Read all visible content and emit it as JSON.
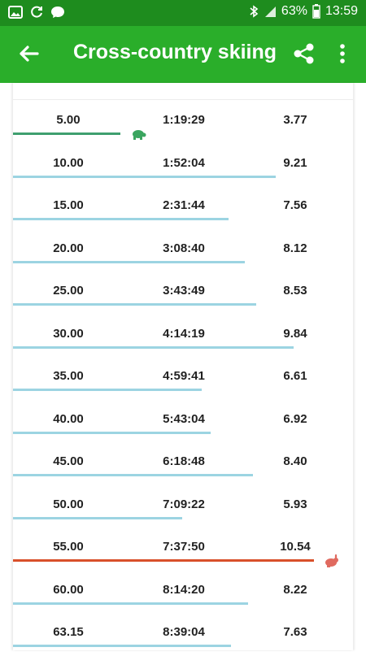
{
  "status_bar": {
    "battery": "63%",
    "time": "13:59",
    "left_icons": [
      "gallery-icon",
      "sync-icon",
      "chat-icon"
    ],
    "right_icons": [
      "bluetooth-icon",
      "signal-icon",
      "battery-icon"
    ]
  },
  "app_bar": {
    "title": "Cross-country skiing",
    "background": "#2aae2a",
    "status_background": "#1e8c1e",
    "icons": [
      "back-arrow-icon",
      "share-icon",
      "more-vert-icon"
    ]
  },
  "splits": [
    {
      "distance": "5.00",
      "time": "1:19:29",
      "speed": "3.77",
      "speed_value": 3.77,
      "marker": "slowest"
    },
    {
      "distance": "10.00",
      "time": "1:52:04",
      "speed": "9.21",
      "speed_value": 9.21
    },
    {
      "distance": "15.00",
      "time": "2:31:44",
      "speed": "7.56",
      "speed_value": 7.56
    },
    {
      "distance": "20.00",
      "time": "3:08:40",
      "speed": "8.12",
      "speed_value": 8.12
    },
    {
      "distance": "25.00",
      "time": "3:43:49",
      "speed": "8.53",
      "speed_value": 8.53
    },
    {
      "distance": "30.00",
      "time": "4:14:19",
      "speed": "9.84",
      "speed_value": 9.84
    },
    {
      "distance": "35.00",
      "time": "4:59:41",
      "speed": "6.61",
      "speed_value": 6.61
    },
    {
      "distance": "40.00",
      "time": "5:43:04",
      "speed": "6.92",
      "speed_value": 6.92
    },
    {
      "distance": "45.00",
      "time": "6:18:48",
      "speed": "8.40",
      "speed_value": 8.4
    },
    {
      "distance": "50.00",
      "time": "7:09:22",
      "speed": "5.93",
      "speed_value": 5.93
    },
    {
      "distance": "55.00",
      "time": "7:37:50",
      "speed": "10.54",
      "speed_value": 10.54,
      "marker": "fastest"
    },
    {
      "distance": "60.00",
      "time": "8:14:20",
      "speed": "8.22",
      "speed_value": 8.22
    },
    {
      "distance": "63.15",
      "time": "8:39:04",
      "speed": "7.63",
      "speed_value": 7.63
    }
  ],
  "colors": {
    "bar_normal": "#9cd4e2",
    "bar_slowest": "#3f9f6f",
    "bar_fastest": "#d9502a",
    "turtle": "#3aa55f",
    "rabbit": "#e06a5f"
  }
}
